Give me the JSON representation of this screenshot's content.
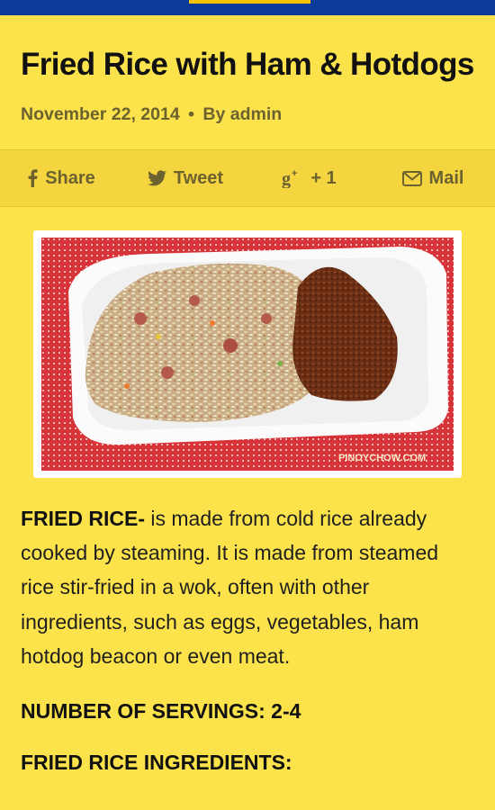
{
  "colors": {
    "page_background": "#fde34b",
    "top_bar": "#0b3b9a",
    "meta_text": "#6b6230"
  },
  "post": {
    "title": "Fried Rice with Ham & Hotdogs",
    "date": "November 22, 2014",
    "separator": "•",
    "author": "By admin"
  },
  "share": {
    "facebook_label": "Share",
    "facebook_icon": "facebook-icon",
    "twitter_label": "Tweet",
    "twitter_icon": "twitter-icon",
    "gplus_label": "+ 1",
    "gplus_icon": "google-plus-icon",
    "mail_label": "Mail",
    "mail_icon": "envelope-icon"
  },
  "image": {
    "description_icon": "fried-rice-photo",
    "watermark": "PINOYCHOW.COM"
  },
  "body": {
    "intro_term": "FRIED RICE-",
    "intro_text": " is made from cold rice already cooked by steaming. It is made from steamed rice stir-fried in a wok, often with other ingredients, such as eggs, vegetables, ham hotdog beacon or even meat.",
    "servings": "NUMBER OF SERVINGS: 2-4",
    "ingredients_heading": "FRIED RICE INGREDIENTS:"
  }
}
